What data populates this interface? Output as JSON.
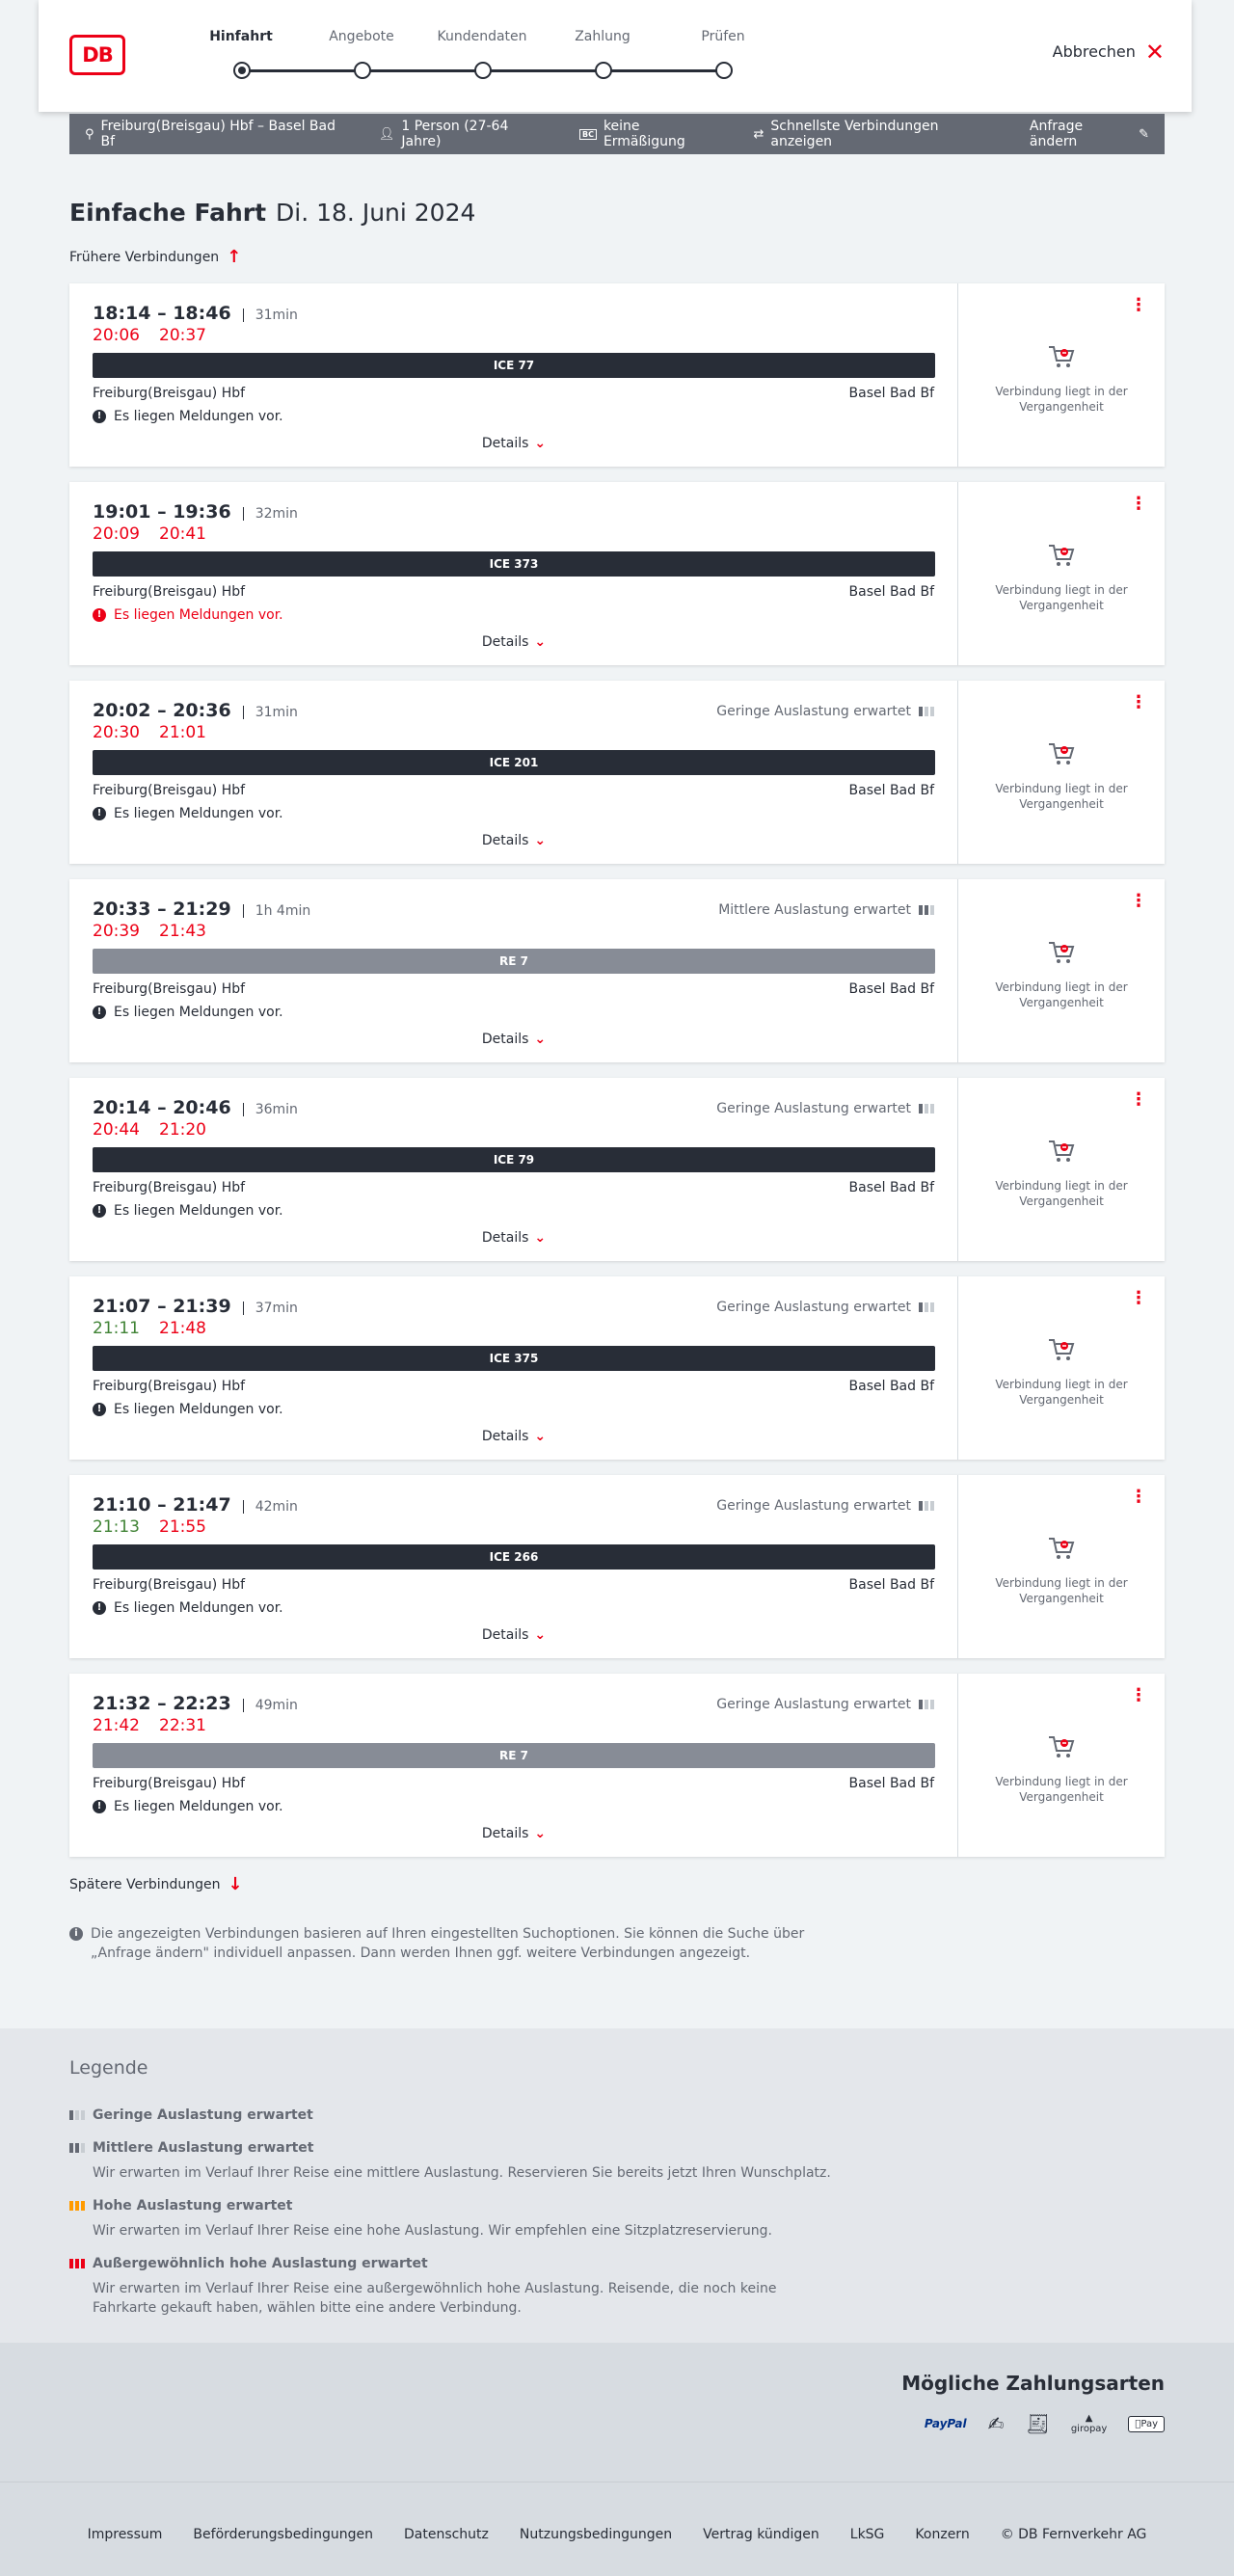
{
  "header": {
    "logo": "DB",
    "steps": [
      "Hinfahrt",
      "Angebote",
      "Kundendaten",
      "Zahlung",
      "Prüfen"
    ],
    "active_step": 0,
    "cancel_label": "Abbrechen"
  },
  "infobar": {
    "route": "Freiburg(Breisgau) Hbf – Basel Bad Bf",
    "persons": "1 Person (27-64 Jahre)",
    "discount_badge": "BC",
    "discount": "keine Ermäßigung",
    "fastest": "Schnellste Verbindungen anzeigen",
    "change": "Anfrage ändern"
  },
  "headline": {
    "title": "Einfache Fahrt",
    "date": "Di. 18. Juni 2024"
  },
  "earlier_label": "Frühere Verbindungen",
  "later_label": "Spätere Verbindungen",
  "details_label": "Details",
  "past_label": "Verbindung liegt in der Vergangenheit",
  "connections": [
    {
      "times": "18:14 – 18:46",
      "duration": "31min",
      "rt_dep": "20:06",
      "rt_dep_color": "red",
      "rt_arr": "20:37",
      "rt_arr_color": "red",
      "load": "",
      "load_level": 0,
      "train": "ICE 77",
      "regio": false,
      "from": "Freiburg(Breisgau) Hbf",
      "to": "Basel Bad Bf",
      "message": "Es liegen Meldungen vor.",
      "message_red": false
    },
    {
      "times": "19:01 – 19:36",
      "duration": "32min",
      "rt_dep": "20:09",
      "rt_dep_color": "red",
      "rt_arr": "20:41",
      "rt_arr_color": "red",
      "load": "",
      "load_level": 0,
      "train": "ICE 373",
      "regio": false,
      "from": "Freiburg(Breisgau) Hbf",
      "to": "Basel Bad Bf",
      "message": "Es liegen Meldungen vor.",
      "message_red": true
    },
    {
      "times": "20:02 – 20:36",
      "duration": "31min",
      "rt_dep": "20:30",
      "rt_dep_color": "red",
      "rt_arr": "21:01",
      "rt_arr_color": "red",
      "load": "Geringe Auslastung erwartet",
      "load_level": 1,
      "train": "ICE 201",
      "regio": false,
      "from": "Freiburg(Breisgau) Hbf",
      "to": "Basel Bad Bf",
      "message": "Es liegen Meldungen vor.",
      "message_red": false
    },
    {
      "times": "20:33 – 21:29",
      "duration": "1h 4min",
      "rt_dep": "20:39",
      "rt_dep_color": "red",
      "rt_arr": "21:43",
      "rt_arr_color": "red",
      "load": "Mittlere Auslastung erwartet",
      "load_level": 2,
      "train": "RE 7",
      "regio": true,
      "from": "Freiburg(Breisgau) Hbf",
      "to": "Basel Bad Bf",
      "message": "Es liegen Meldungen vor.",
      "message_red": false
    },
    {
      "times": "20:14 – 20:46",
      "duration": "36min",
      "rt_dep": "20:44",
      "rt_dep_color": "red",
      "rt_arr": "21:20",
      "rt_arr_color": "red",
      "load": "Geringe Auslastung erwartet",
      "load_level": 1,
      "train": "ICE 79",
      "regio": false,
      "from": "Freiburg(Breisgau) Hbf",
      "to": "Basel Bad Bf",
      "message": "Es liegen Meldungen vor.",
      "message_red": false
    },
    {
      "times": "21:07 – 21:39",
      "duration": "37min",
      "rt_dep": "21:11",
      "rt_dep_color": "green",
      "rt_arr": "21:48",
      "rt_arr_color": "red",
      "load": "Geringe Auslastung erwartet",
      "load_level": 1,
      "train": "ICE 375",
      "regio": false,
      "from": "Freiburg(Breisgau) Hbf",
      "to": "Basel Bad Bf",
      "message": "Es liegen Meldungen vor.",
      "message_red": false
    },
    {
      "times": "21:10 – 21:47",
      "duration": "42min",
      "rt_dep": "21:13",
      "rt_dep_color": "green",
      "rt_arr": "21:55",
      "rt_arr_color": "red",
      "load": "Geringe Auslastung erwartet",
      "load_level": 1,
      "train": "ICE 266",
      "regio": false,
      "from": "Freiburg(Breisgau) Hbf",
      "to": "Basel Bad Bf",
      "message": "Es liegen Meldungen vor.",
      "message_red": false
    },
    {
      "times": "21:32 – 22:23",
      "duration": "49min",
      "rt_dep": "21:42",
      "rt_dep_color": "red",
      "rt_arr": "22:31",
      "rt_arr_color": "red",
      "load": "Geringe Auslastung erwartet",
      "load_level": 1,
      "train": "RE 7",
      "regio": true,
      "from": "Freiburg(Breisgau) Hbf",
      "to": "Basel Bad Bf",
      "message": "Es liegen Meldungen vor.",
      "message_red": false
    }
  ],
  "note": "Die angezeigten Verbindungen basieren auf Ihren eingestellten Suchoptionen. Sie können die Suche über „Anfrage ändern\" individuell anpassen. Dann werden Ihnen ggf. weitere Verbindungen angezeigt.",
  "legend": {
    "title": "Legende",
    "items": [
      {
        "title": "Geringe Auslastung erwartet",
        "desc": ""
      },
      {
        "title": "Mittlere Auslastung erwartet",
        "desc": "Wir erwarten im Verlauf Ihrer Reise eine mittlere Auslastung. Reservieren Sie bereits jetzt Ihren Wunschplatz."
      },
      {
        "title": "Hohe Auslastung erwartet",
        "desc": "Wir erwarten im Verlauf Ihrer Reise eine hohe Auslastung. Wir empfehlen eine Sitzplatzreservierung."
      },
      {
        "title": "Außergewöhnlich hohe Auslastung erwartet",
        "desc": "Wir erwarten im Verlauf Ihrer Reise eine außergewöhnlich hohe Auslastung. Reisende, die noch keine Fahrkarte gekauft haben, wählen bitte eine andere Verbindung."
      }
    ]
  },
  "payment": {
    "title": "Mögliche Zahlungsarten",
    "methods": [
      "PayPal",
      "Lastschrift",
      "Rechnung",
      "giropay",
      "Pay"
    ]
  },
  "footer": {
    "links": [
      "Impressum",
      "Beförderungsbedingungen",
      "Datenschutz",
      "Nutzungsbedingungen",
      "Vertrag kündigen",
      "LkSG",
      "Konzern",
      "© DB Fernverkehr AG"
    ]
  },
  "colors": {
    "brand_red": "#ec0016",
    "ontime_green": "#408335",
    "train_bar": "#282d37",
    "regio_bar": "#878c96"
  }
}
